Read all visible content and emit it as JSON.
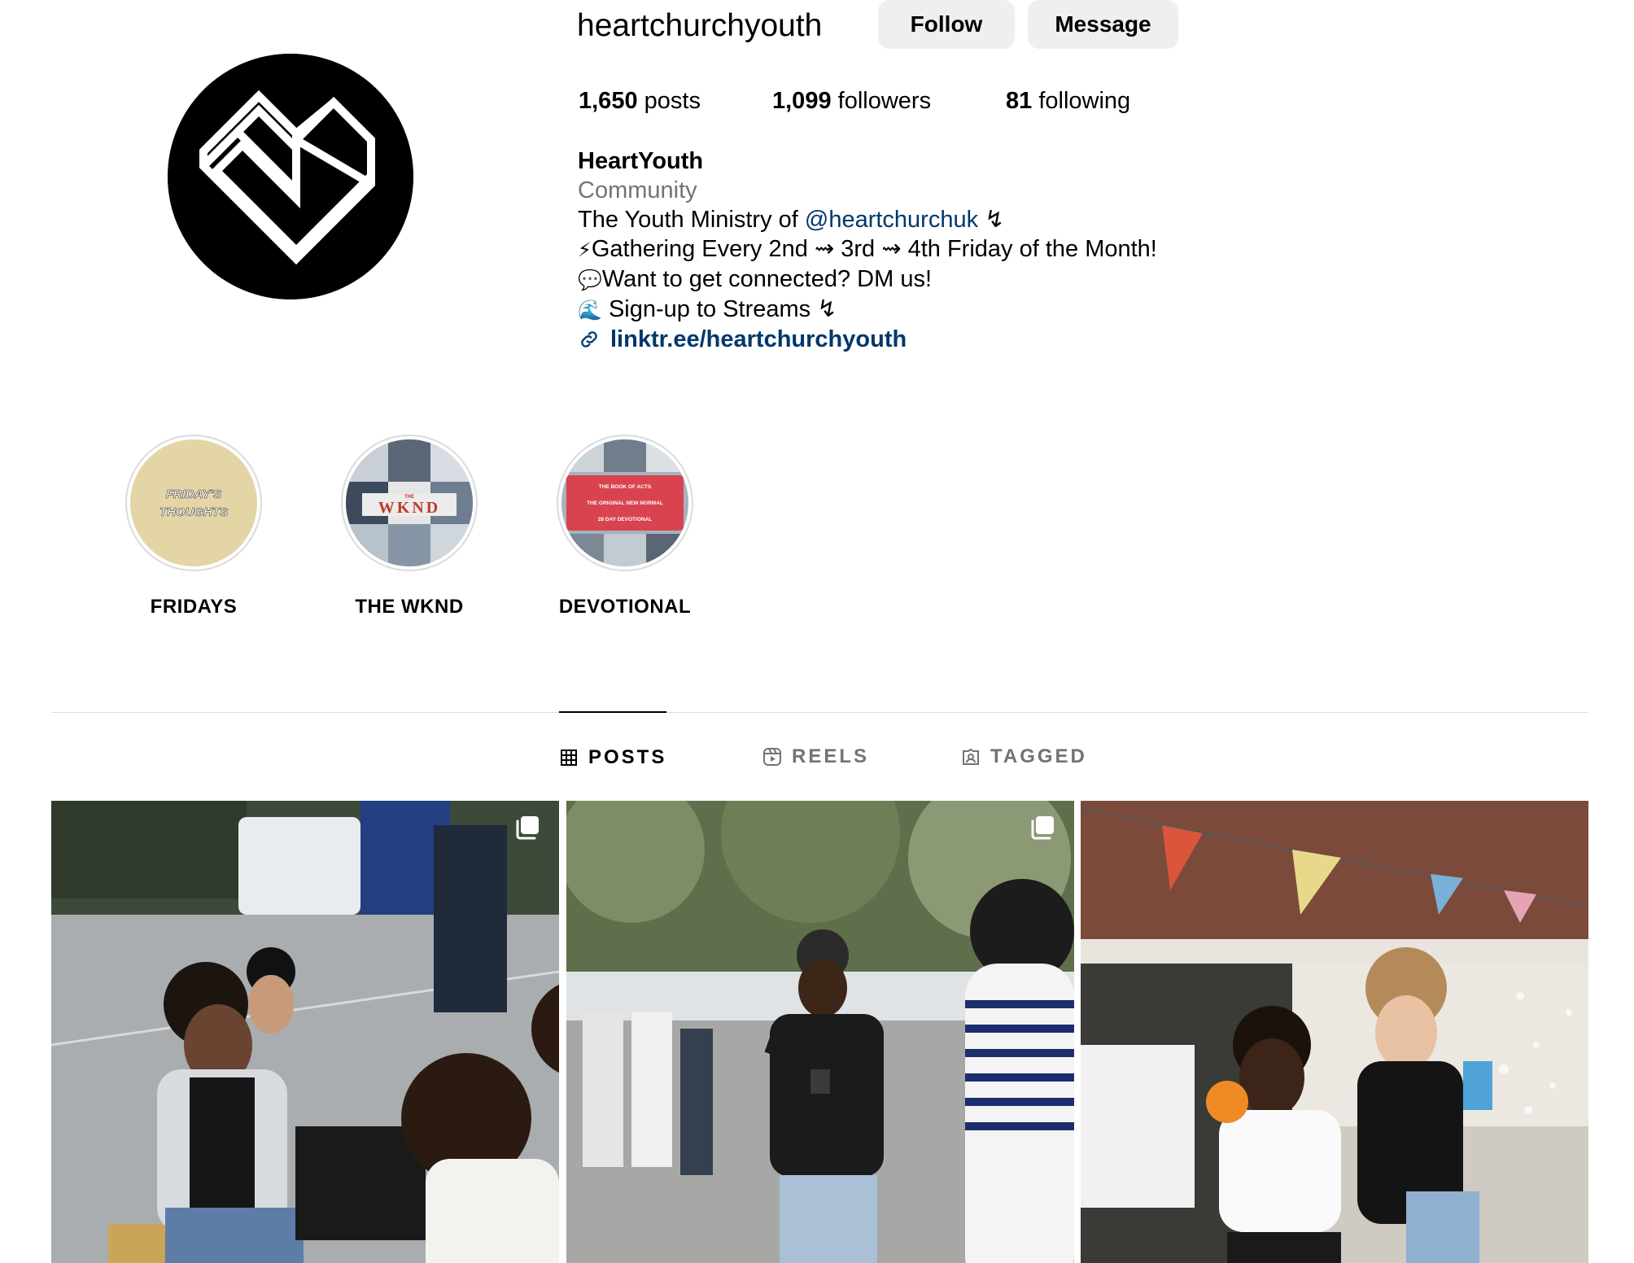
{
  "profile": {
    "username": "heartchurchyouth",
    "follow_label": "Follow",
    "message_label": "Message"
  },
  "stats": {
    "posts_count": "1,650",
    "posts_label": "posts",
    "followers_count": "1,099",
    "followers_label": "followers",
    "following_count": "81",
    "following_label": "following"
  },
  "bio": {
    "name": "HeartYouth",
    "category": "Community",
    "line1_prefix": "The Youth Ministry of ",
    "line1_mention": "@heartchurchuk",
    "line1_suffix": " ↯",
    "line2_emoji": "⚡",
    "line2_text": "Gathering Every 2nd ⇝ 3rd ⇝ 4th Friday of the Month!",
    "line3_emoji": "💬",
    "line3_text": "Want to get connected? DM us!",
    "line4_emoji": "🌊",
    "line4_text": " Sign-up to Streams ↯",
    "link": "linktr.ee/heartchurchyouth"
  },
  "highlights": [
    {
      "label": "FRIDAYS",
      "cover_text": [
        "FRIDAY'S",
        "THOUGHTS"
      ],
      "cover_color": "#e3d5a6"
    },
    {
      "label": "THE WKND",
      "cover_text": [
        "THE",
        "WKND"
      ],
      "cover_color": "#9aa7b4"
    },
    {
      "label": "DEVOTIONAL",
      "cover_text": [
        "THE BOOK OF ACTS",
        "THE ORIGINAL NEW NORMAL",
        "28 DAY DEVOTIONAL"
      ],
      "cover_color": "#d9434f"
    }
  ],
  "tabs": [
    {
      "label": "POSTS",
      "icon": "grid-icon",
      "active": true
    },
    {
      "label": "REELS",
      "icon": "reels-icon",
      "active": false
    },
    {
      "label": "TAGGED",
      "icon": "tagged-icon",
      "active": false
    }
  ],
  "posts": [
    {
      "icon": "multiple-images-icon"
    },
    {
      "icon": "multiple-images-icon"
    },
    {
      "icon": ""
    }
  ],
  "colors": {
    "button_bg": "#efefef",
    "link_color": "#00376b",
    "muted": "#737373",
    "divider": "#dbdbdb"
  }
}
